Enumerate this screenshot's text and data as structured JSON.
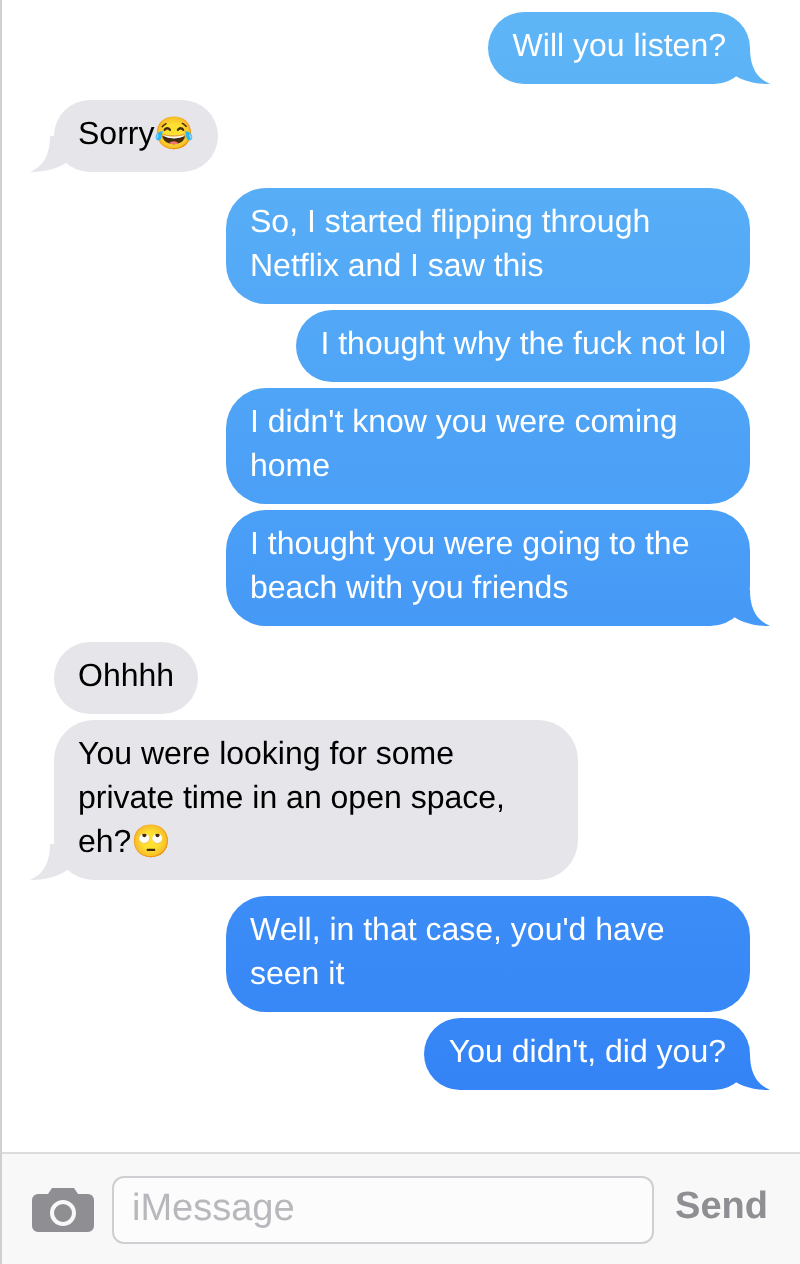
{
  "groups": [
    {
      "kind": "outgoing",
      "messages": [
        "Will you listen?"
      ]
    },
    {
      "kind": "incoming",
      "messages": [
        "Sorry😂"
      ]
    },
    {
      "kind": "outgoing",
      "messages": [
        "So, I started flipping through Netflix and I saw this",
        "I thought why the fuck not lol",
        "I didn't know you were coming home",
        "I thought you were going to the beach with you friends"
      ]
    },
    {
      "kind": "incoming",
      "messages": [
        "Ohhhh",
        "You were looking for some private time in an open space, eh?🙄"
      ]
    },
    {
      "kind": "outgoing",
      "messages": [
        "Well, in that case, you'd have seen it",
        "You didn't, did you?"
      ]
    }
  ],
  "composer": {
    "placeholder": "iMessage",
    "send_label": "Send"
  }
}
